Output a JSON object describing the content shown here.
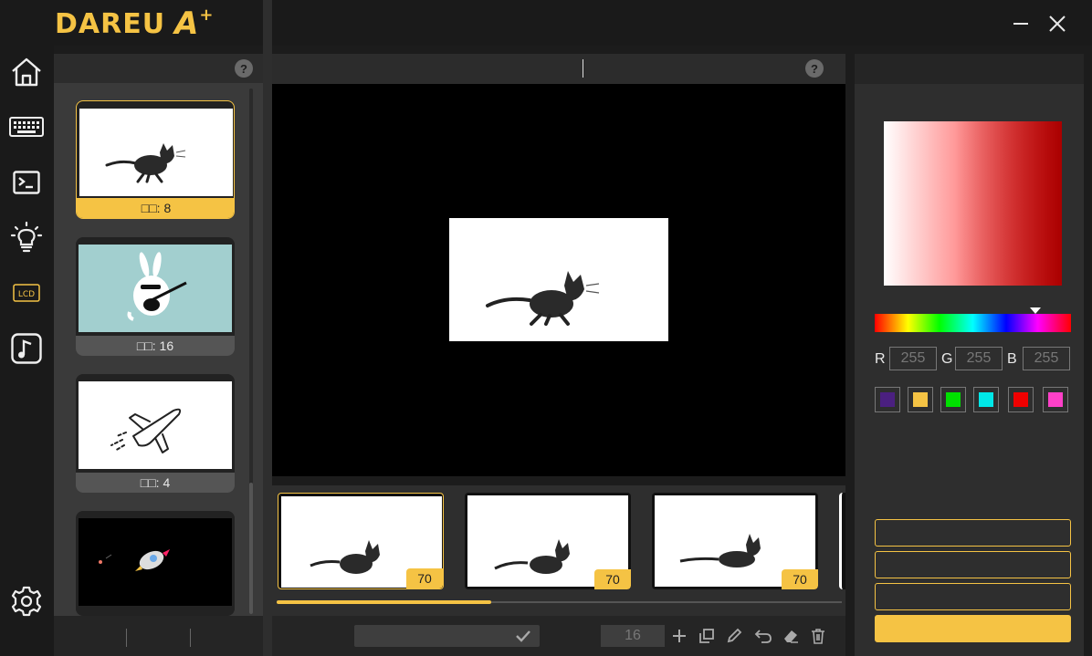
{
  "app": {
    "logo_text": "DAREU",
    "logo_mark": "A",
    "logo_plus": "+"
  },
  "colors": {
    "accent": "#f5c344",
    "panel": "#3a3a3a",
    "stage": "#000000"
  },
  "window": {
    "minimize_icon": "minimize-icon",
    "close_icon": "close-icon"
  },
  "nav": [
    {
      "name": "home",
      "icon": "home-icon"
    },
    {
      "name": "keyboard",
      "icon": "keyboard-icon"
    },
    {
      "name": "macro",
      "icon": "terminal-icon"
    },
    {
      "name": "lighting",
      "icon": "lightbulb-icon"
    },
    {
      "name": "lcd",
      "icon": "lcd-icon",
      "text": "LCD"
    },
    {
      "name": "music",
      "icon": "music-note-icon"
    },
    {
      "name": "settings",
      "icon": "gear-icon"
    }
  ],
  "library": {
    "help": "?",
    "items": [
      {
        "caption": "□□: 8",
        "image": "running-cat"
      },
      {
        "caption": "□□: 16",
        "image": "rabbit-guitar"
      },
      {
        "caption": "□□: 4",
        "image": "airplane"
      },
      {
        "caption": "",
        "image": "rocket"
      }
    ]
  },
  "editor": {
    "help": "?",
    "frames": [
      {
        "duration": "70"
      },
      {
        "duration": "70"
      },
      {
        "duration": "70"
      }
    ],
    "progress": 0.38,
    "frame_count": "16",
    "tools": [
      "plus-icon",
      "copy-icon",
      "pencil-icon",
      "undo-icon",
      "eraser-icon",
      "trash-icon"
    ]
  },
  "color_picker": {
    "r_label": "R",
    "g_label": "G",
    "b_label": "B",
    "r": "255",
    "g": "255",
    "b": "255",
    "hue_position": 0.82,
    "swatches": [
      "#4b2080",
      "#f5c344",
      "#00e000",
      "#00e8e8",
      "#f00000",
      "#ff40c8"
    ]
  }
}
